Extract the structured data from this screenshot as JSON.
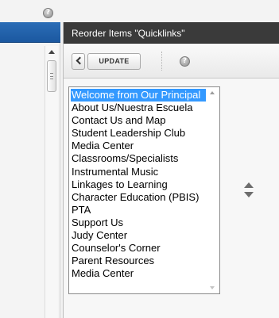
{
  "top": {
    "help_icon": "help-icon",
    "help_glyph": "?"
  },
  "dialog": {
    "title": "Reorder Items \"Quicklinks\"",
    "toolbar": {
      "back_icon": "chevron-left-icon",
      "update_label": "UPDATE",
      "help_glyph": "?"
    },
    "list": {
      "selected_index": 0,
      "items": [
        "Welcome from Our Principal",
        "About Us/Nuestra Escuela",
        "Contact Us and Map",
        "Student Leadership Club",
        "Media Center",
        "Classrooms/Specialists",
        "Instrumental Music",
        "Linkages to Learning",
        "Character Education (PBIS)",
        "PTA",
        "Support Us",
        "Judy Center",
        "Counselor's Corner",
        "Parent Resources",
        "Media Center"
      ]
    },
    "move_icons": {
      "up": "move-up-icon",
      "down": "move-down-icon"
    }
  },
  "colors": {
    "selected": "#3399ff",
    "header": "#3a3a3a",
    "left_bar": "#1f5ea8"
  }
}
